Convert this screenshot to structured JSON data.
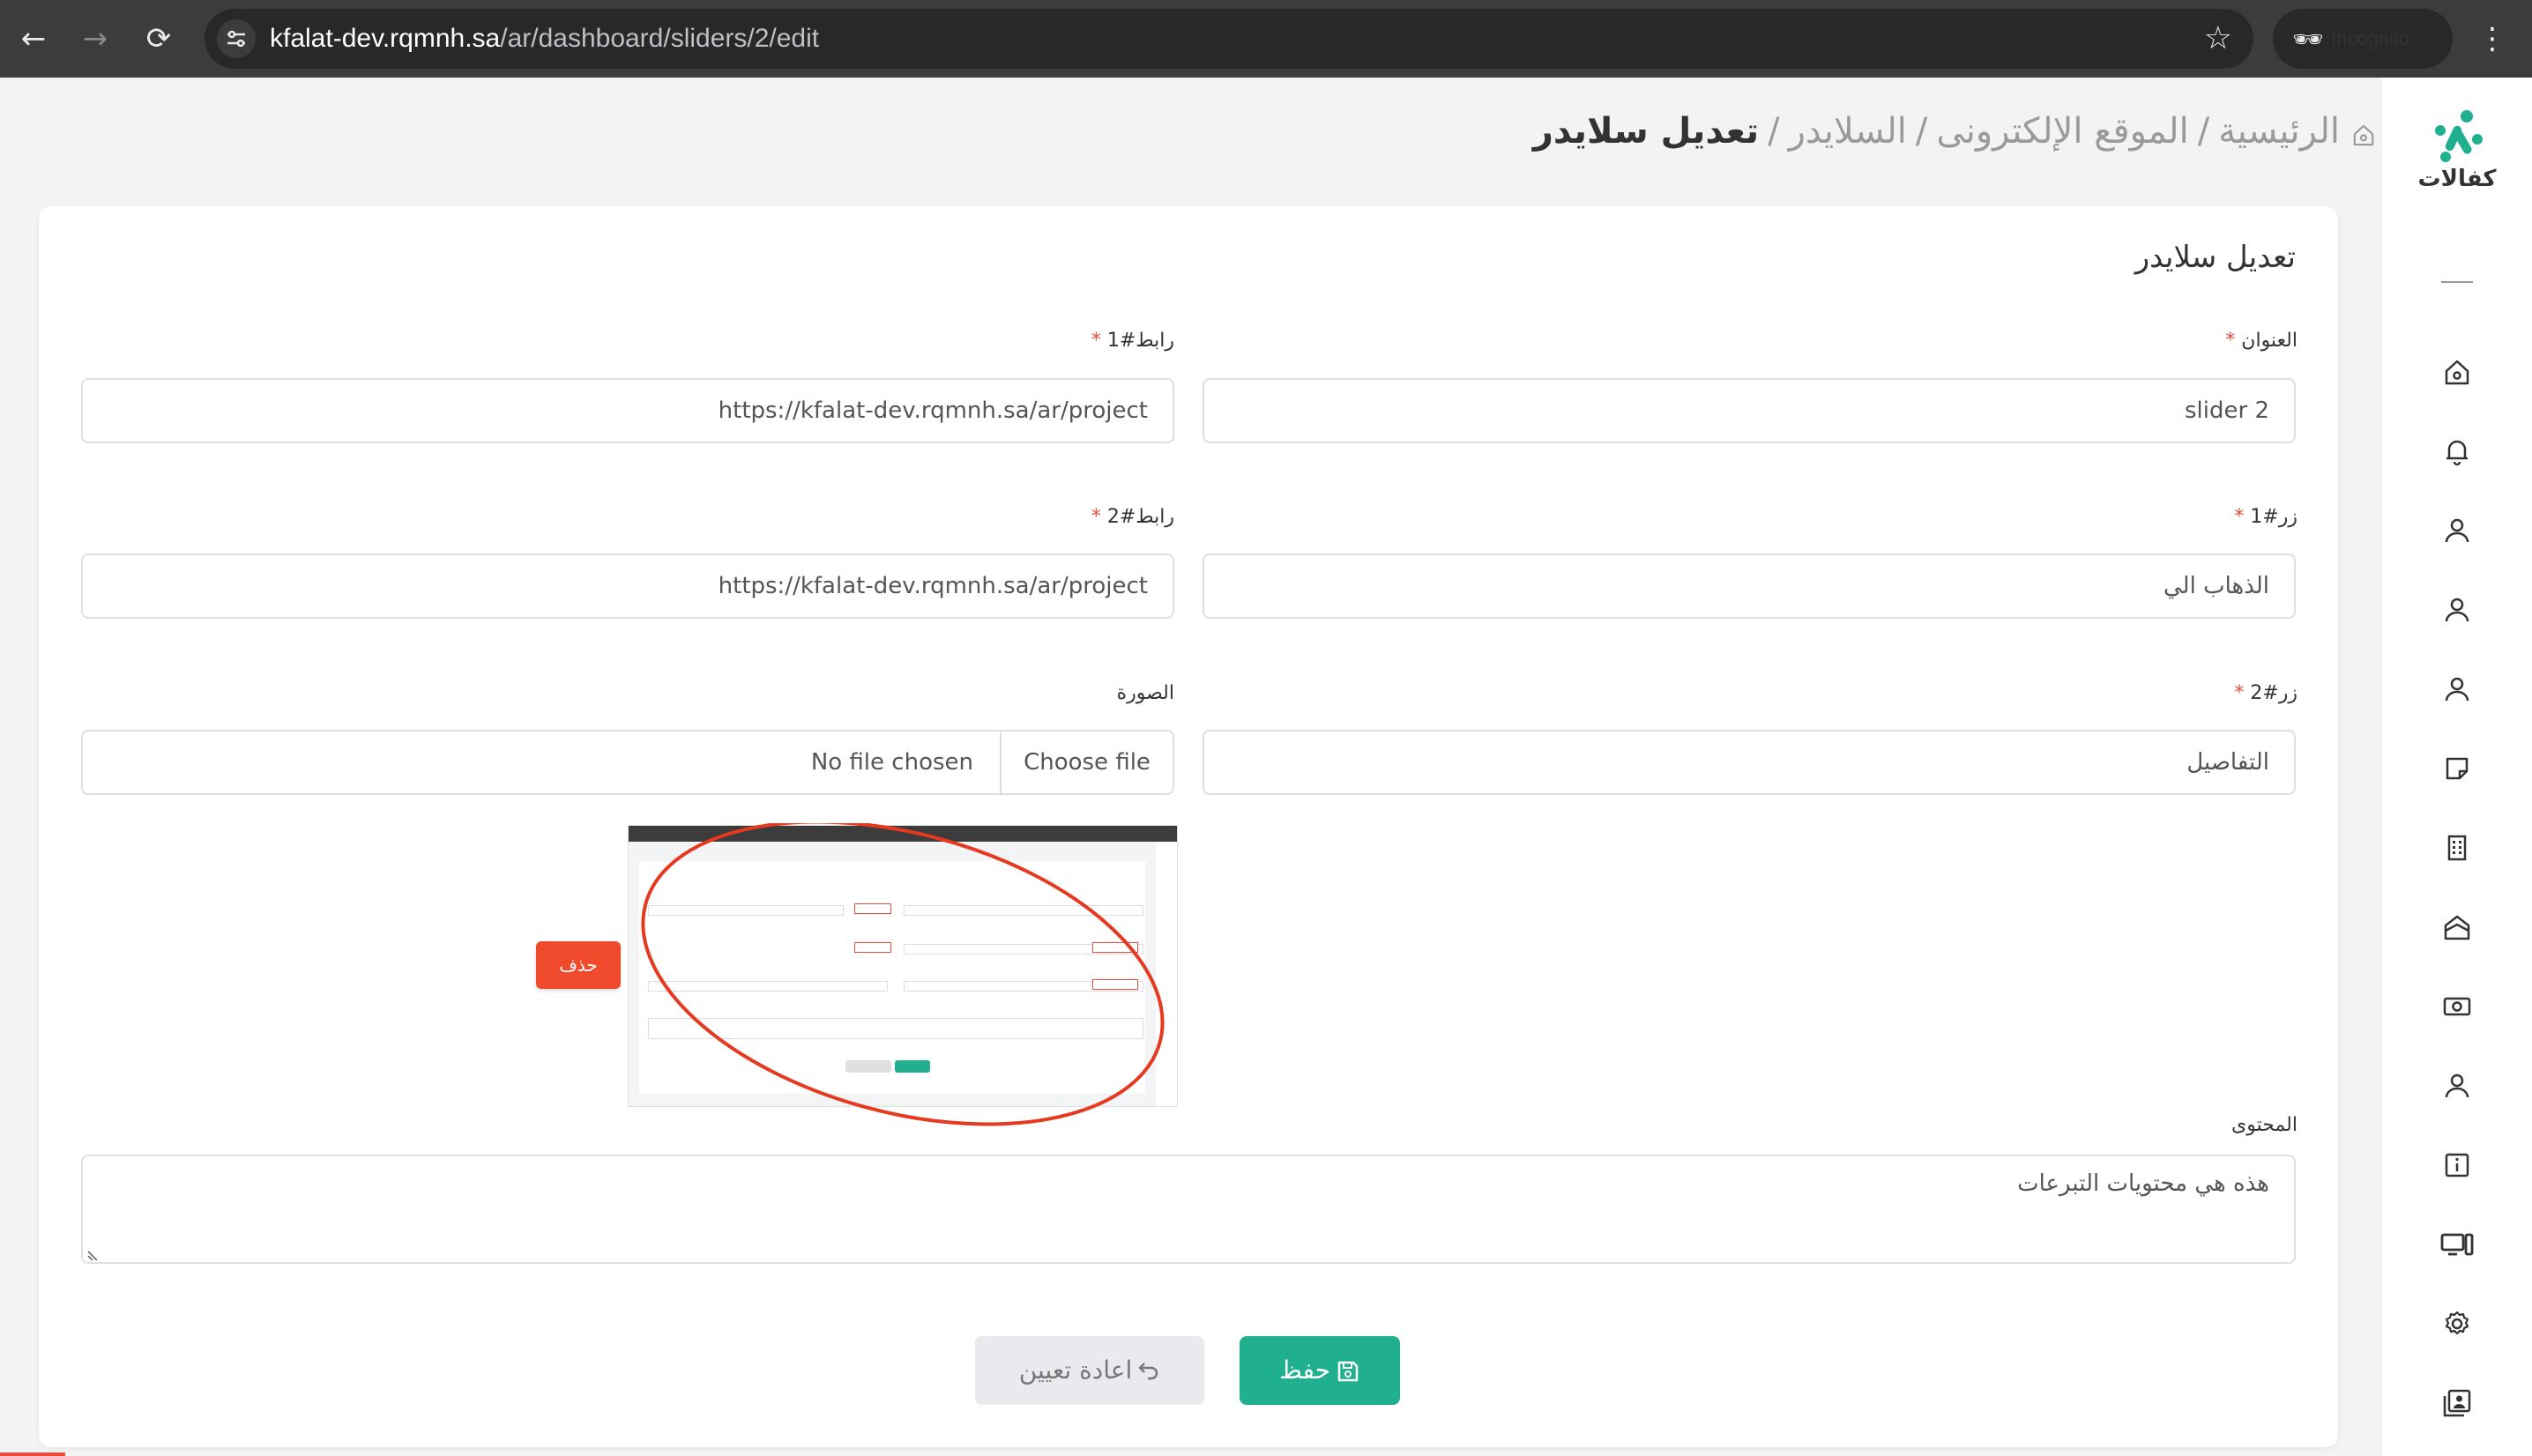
{
  "browser": {
    "url_host": "kfalat-dev.rqmnh.sa",
    "url_path": "/ar/dashboard/sliders/2/edit",
    "incognito_label": "Incognito"
  },
  "sidebar": {
    "logo_text": "كفالات",
    "items": [
      "home-icon",
      "bell-icon",
      "user-icon",
      "user-icon",
      "user-icon",
      "note-icon",
      "building-icon",
      "home-alt-icon",
      "money-icon",
      "user-icon",
      "info-icon",
      "devices-icon",
      "gear-icon",
      "contacts-icon"
    ]
  },
  "breadcrumb": {
    "home": "الرئيسية",
    "site": "الموقع الإلكترونى",
    "sliders": "السلايدر",
    "current": "تعديل سلايدر",
    "separator": "/"
  },
  "form": {
    "title": "تعديل سلايدر",
    "title_label": "العنوان",
    "title_value": "slider 2",
    "link1_label": "رابط#1",
    "link1_value": "https://kfalat-dev.rqmnh.sa/ar/project",
    "button1_label": "زر#1",
    "button1_value": "الذهاب الي",
    "link2_label": "رابط#2",
    "link2_value": "https://kfalat-dev.rqmnh.sa/ar/project",
    "button2_label": "زر#2",
    "button2_value": "التفاصيل",
    "image_label": "الصورة",
    "choose_file": "Choose file",
    "no_file": "No file chosen",
    "delete_label": "حذف",
    "content_label": "المحتوى",
    "content_value": "هذه هي محتويات التبرعات",
    "required_mark": "*",
    "save_label": "حفظ",
    "reset_label": "اعادة تعيين"
  },
  "colors": {
    "accent": "#20b08f",
    "danger": "#f04a2c",
    "required": "#e74c3c"
  }
}
